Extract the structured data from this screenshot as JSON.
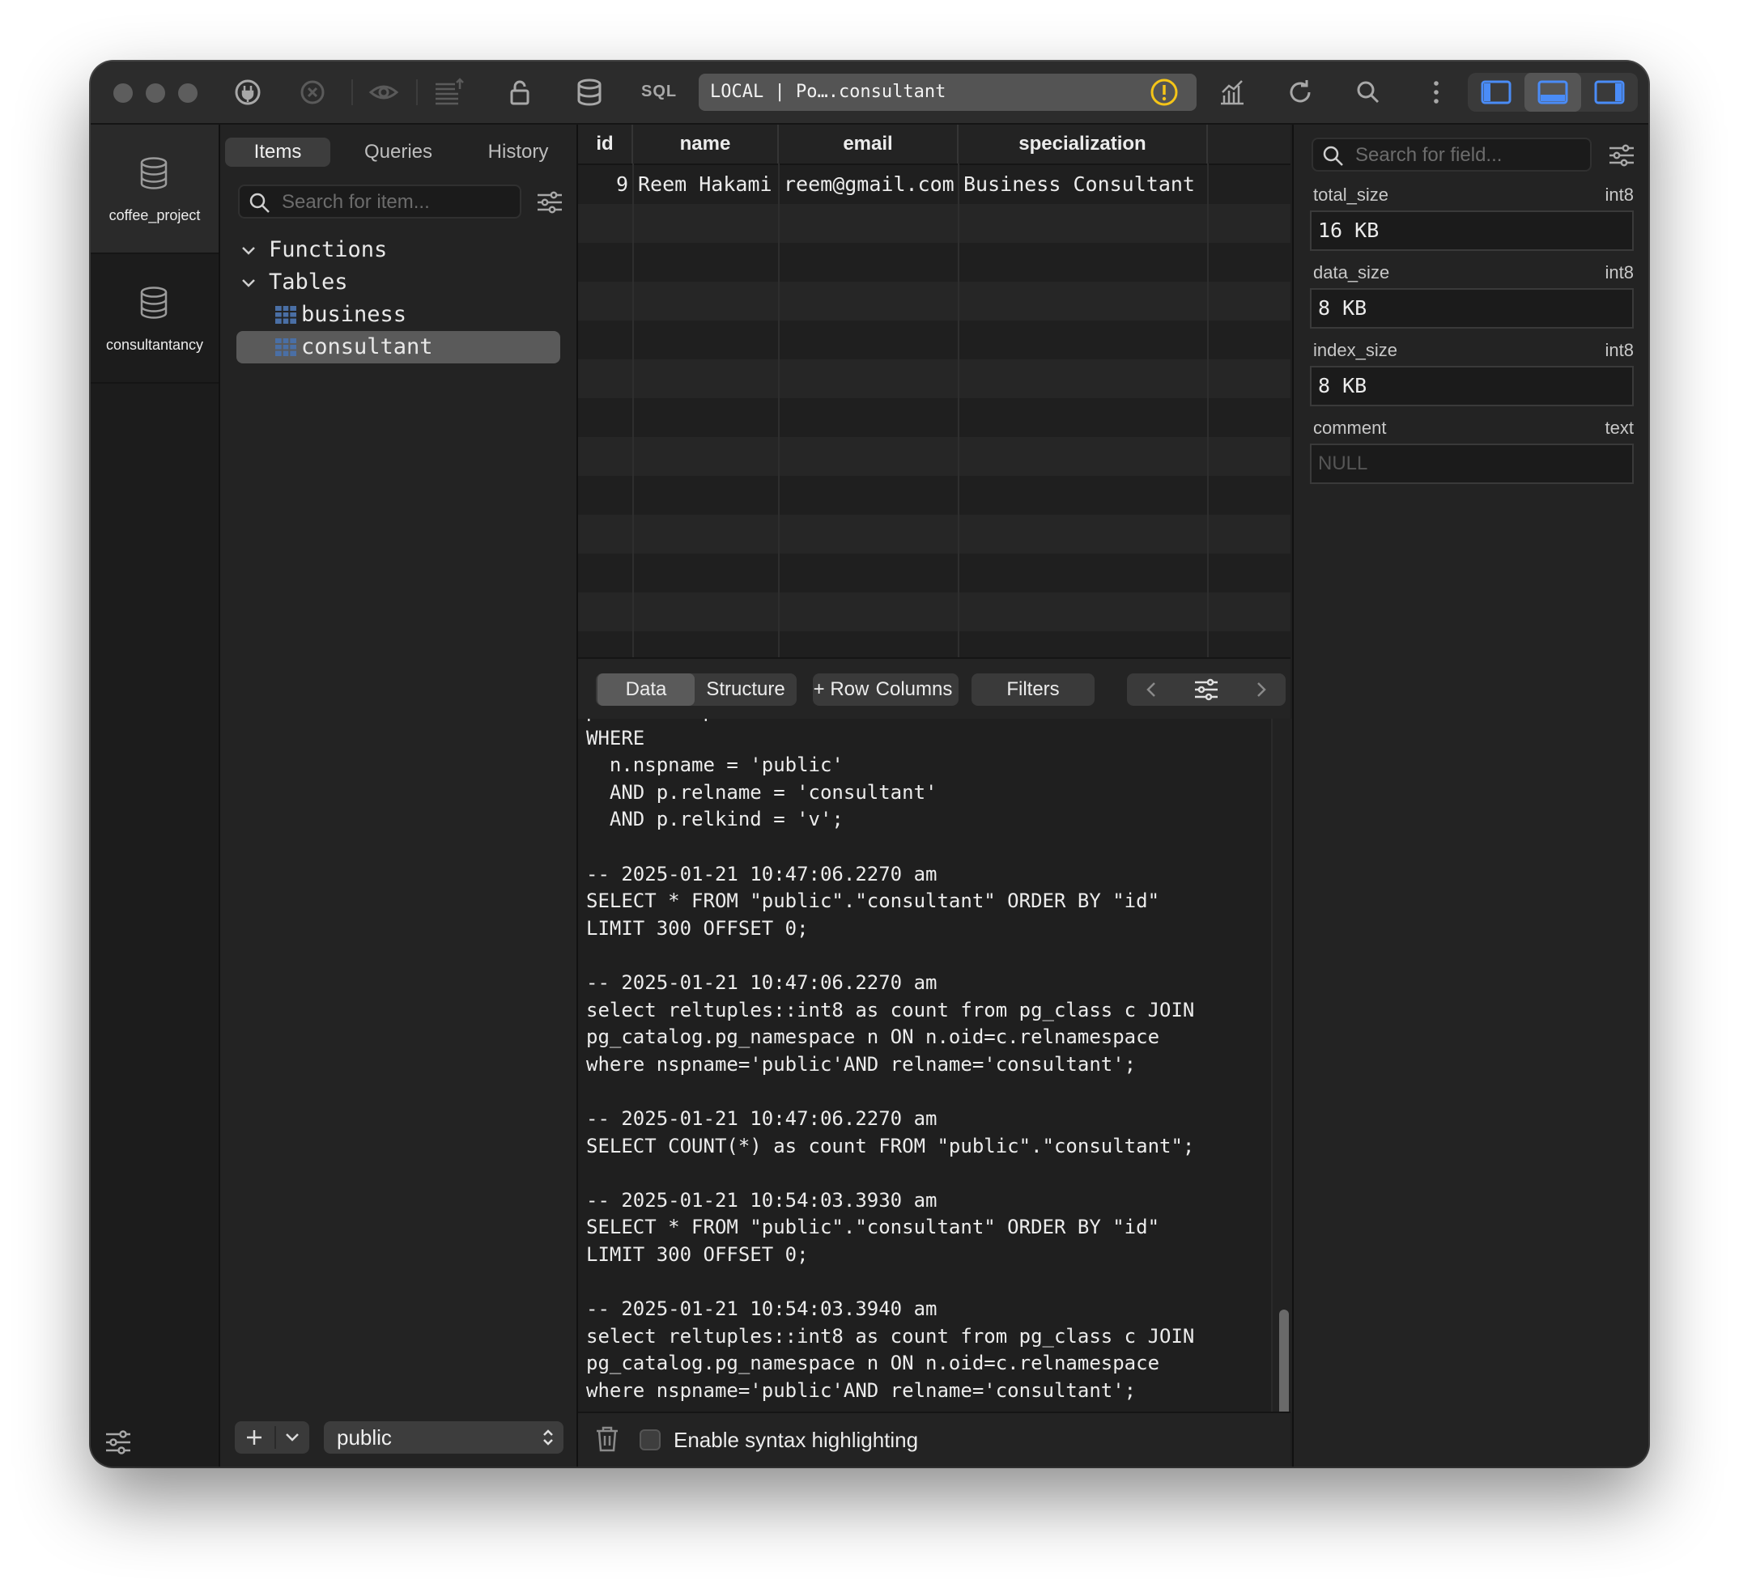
{
  "toolbar": {
    "sql_label": "SQL",
    "connection": "LOCAL | Po….consultant",
    "icons": [
      "plug-icon",
      "close-circle-icon",
      "eye-icon",
      "list-upload-icon",
      "lock-icon",
      "database-icon",
      "warning-icon",
      "chart-icon",
      "refresh-icon",
      "search-icon",
      "more-icon",
      "toggle-left-panel-icon",
      "toggle-bottom-panel-icon",
      "toggle-right-panel-icon"
    ],
    "warning_color": "#f5c518",
    "accent_color": "#4a8cf7"
  },
  "rail": {
    "databases": [
      {
        "label": "coffee_project"
      },
      {
        "label": "consultantancy"
      }
    ]
  },
  "navigator": {
    "tabs": [
      {
        "label": "Items"
      },
      {
        "label": "Queries"
      },
      {
        "label": "History"
      }
    ],
    "search_placeholder": "Search for item...",
    "tree": {
      "functions_label": "Functions",
      "tables_label": "Tables",
      "tables": [
        {
          "label": "business"
        },
        {
          "label": "consultant"
        }
      ]
    },
    "schema": "public"
  },
  "grid": {
    "columns": [
      "id",
      "name",
      "email",
      "specialization"
    ],
    "rows": [
      {
        "id": "9",
        "name": "Reem Hakami",
        "email": "reem@gmail.com",
        "specialization": "Business Consultant"
      }
    ]
  },
  "grid_bar": {
    "data_label": "Data",
    "structure_label": "Structure",
    "row_label": "+ Row",
    "columns_label": "Columns",
    "filters_label": "Filters"
  },
  "console": {
    "log": "p.relnamespace\nWHERE\n  n.nspname = 'public'\n  AND p.relname = 'consultant'\n  AND p.relkind = 'v';\n\n-- 2025-01-21 10:47:06.2270 am\nSELECT * FROM \"public\".\"consultant\" ORDER BY \"id\"\nLIMIT 300 OFFSET 0;\n\n-- 2025-01-21 10:47:06.2270 am\nselect reltuples::int8 as count from pg_class c JOIN\npg_catalog.pg_namespace n ON n.oid=c.relnamespace\nwhere nspname='public'AND relname='consultant';\n\n-- 2025-01-21 10:47:06.2270 am\nSELECT COUNT(*) as count FROM \"public\".\"consultant\";\n\n-- 2025-01-21 10:54:03.3930 am\nSELECT * FROM \"public\".\"consultant\" ORDER BY \"id\"\nLIMIT 300 OFFSET 0;\n\n-- 2025-01-21 10:54:03.3940 am\nselect reltuples::int8 as count from pg_class c JOIN\npg_catalog.pg_namespace n ON n.oid=c.relnamespace\nwhere nspname='public'AND relname='consultant';",
    "syntax_label": "Enable syntax highlighting"
  },
  "inspector": {
    "search_placeholder": "Search for field...",
    "fields": [
      {
        "name": "total_size",
        "type": "int8",
        "value": "16 KB"
      },
      {
        "name": "data_size",
        "type": "int8",
        "value": "8 KB"
      },
      {
        "name": "index_size",
        "type": "int8",
        "value": "8 KB"
      },
      {
        "name": "comment",
        "type": "text",
        "value": "NULL"
      }
    ]
  }
}
